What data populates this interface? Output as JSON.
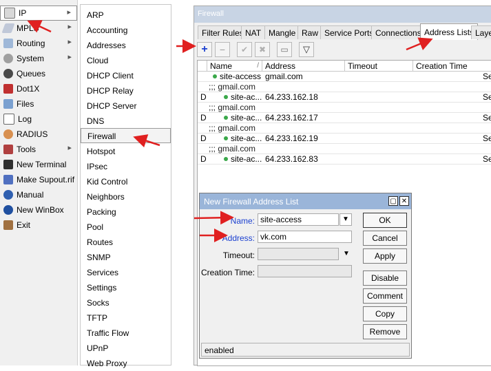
{
  "left_menu": {
    "items": [
      {
        "label": "IP",
        "icon": "ip-icon",
        "has_submenu": true,
        "selected": true
      },
      {
        "label": "MPLS",
        "icon": "mpls-icon",
        "has_submenu": true
      },
      {
        "label": "Routing",
        "icon": "routing-icon",
        "has_submenu": true
      },
      {
        "label": "System",
        "icon": "gear-icon",
        "has_submenu": true
      },
      {
        "label": "Queues",
        "icon": "queues-icon"
      },
      {
        "label": "Dot1X",
        "icon": "dot1x-icon"
      },
      {
        "label": "Files",
        "icon": "folder-icon"
      },
      {
        "label": "Log",
        "icon": "log-icon"
      },
      {
        "label": "RADIUS",
        "icon": "radius-icon"
      },
      {
        "label": "Tools",
        "icon": "tools-icon",
        "has_submenu": true
      },
      {
        "label": "New Terminal",
        "icon": "terminal-icon"
      },
      {
        "label": "Make Supout.rif",
        "icon": "supout-icon"
      },
      {
        "label": "Manual",
        "icon": "help-icon"
      },
      {
        "label": "New WinBox",
        "icon": "winbox-icon"
      },
      {
        "label": "Exit",
        "icon": "exit-icon"
      }
    ]
  },
  "submenu": {
    "items": [
      "ARP",
      "Accounting",
      "Addresses",
      "Cloud",
      "DHCP Client",
      "DHCP Relay",
      "DHCP Server",
      "DNS",
      "Firewall",
      "Hotspot",
      "IPsec",
      "Kid Control",
      "Neighbors",
      "Packing",
      "Pool",
      "Routes",
      "SNMP",
      "Services",
      "Settings",
      "Socks",
      "TFTP",
      "Traffic Flow",
      "UPnP",
      "Web Proxy"
    ],
    "selected": "Firewall"
  },
  "firewall": {
    "title": "Firewall",
    "tabs": [
      "Filter Rules",
      "NAT",
      "Mangle",
      "Raw",
      "Service Ports",
      "Connections",
      "Address Lists",
      "Laye"
    ],
    "active_tab": "Address Lists",
    "toolbar": {
      "add": "+",
      "remove": "−",
      "enable": "✔",
      "disable": "✖",
      "comment": "▭",
      "filter": "▽"
    },
    "columns": [
      "Name",
      "Address",
      "Timeout",
      "Creation Time"
    ],
    "sort_indicator": "/",
    "rows": [
      {
        "flag": "",
        "comment": "",
        "name": "site-access",
        "address": "gmail.com",
        "trailing": "Se"
      },
      {
        "flag": "",
        "comment": ";;; gmail.com",
        "name": "",
        "address": "",
        "trailing": ""
      },
      {
        "flag": "D",
        "comment": "",
        "name": "site-ac...",
        "address": "64.233.162.18",
        "trailing": "Se"
      },
      {
        "flag": "",
        "comment": ";;; gmail.com",
        "name": "",
        "address": "",
        "trailing": ""
      },
      {
        "flag": "D",
        "comment": "",
        "name": "site-ac...",
        "address": "64.233.162.17",
        "trailing": "Se"
      },
      {
        "flag": "",
        "comment": ";;; gmail.com",
        "name": "",
        "address": "",
        "trailing": ""
      },
      {
        "flag": "D",
        "comment": "",
        "name": "site-ac...",
        "address": "64.233.162.19",
        "trailing": "Se"
      },
      {
        "flag": "",
        "comment": ";;; gmail.com",
        "name": "",
        "address": "",
        "trailing": ""
      },
      {
        "flag": "D",
        "comment": "",
        "name": "site-ac...",
        "address": "64.233.162.83",
        "trailing": "Se"
      }
    ]
  },
  "dialog": {
    "title": "New Firewall Address List",
    "fields": {
      "name_label": "Name:",
      "name_value": "site-access",
      "address_label": "Address:",
      "address_value": "vk.com",
      "timeout_label": "Timeout:",
      "timeout_value": "",
      "creation_label": "Creation Time:",
      "creation_value": ""
    },
    "buttons": [
      "OK",
      "Cancel",
      "Apply",
      "Disable",
      "Comment",
      "Copy",
      "Remove"
    ],
    "status": "enabled"
  },
  "colors": {
    "annotation_arrow": "#e02020",
    "field_label_blue": "#1a3fd0",
    "row_dot": "#3aa84a",
    "dialog_titlebar": "#9ab5d9",
    "window_titlebar": "#c8d4e4"
  }
}
